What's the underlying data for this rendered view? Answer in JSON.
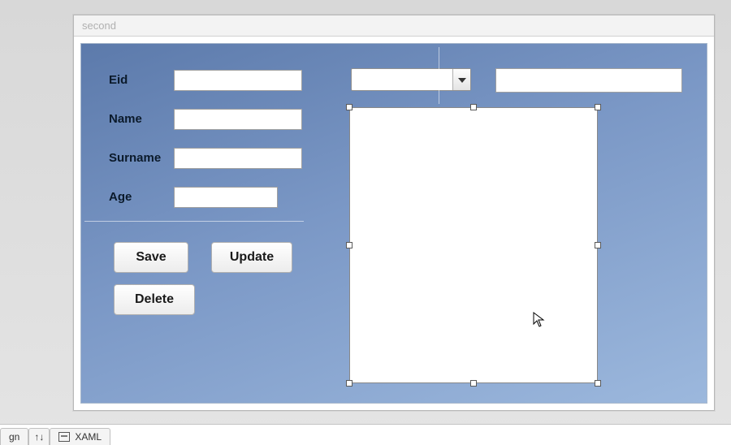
{
  "window": {
    "title": "second"
  },
  "form": {
    "labels": {
      "eid": "Eid",
      "name": "Name",
      "surname": "Surname",
      "age": "Age"
    },
    "fields": {
      "eid": "",
      "name": "",
      "surname": "",
      "age": ""
    },
    "combo": {
      "selected": ""
    },
    "extra_textbox": ""
  },
  "buttons": {
    "save": "Save",
    "update": "Update",
    "delete": "Delete"
  },
  "tabs": {
    "design_fragment": "gn",
    "swap_glyph": "↑↓",
    "xaml": "XAML"
  }
}
